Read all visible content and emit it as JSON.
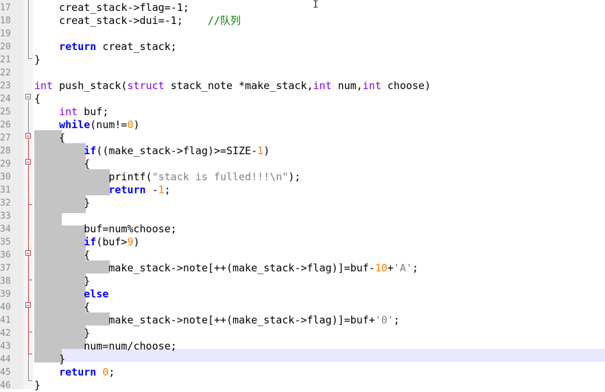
{
  "editor": {
    "lines": [
      {
        "n": "17",
        "parts": [
          {
            "t": "    creat_stack->flag=-1;",
            "c": ""
          }
        ]
      },
      {
        "n": "18",
        "parts": [
          {
            "t": "    creat_stack->dui=-1;    ",
            "c": ""
          },
          {
            "t": "//队列",
            "c": "cm"
          }
        ]
      },
      {
        "n": "19",
        "parts": [
          {
            "t": "",
            "c": ""
          }
        ]
      },
      {
        "n": "20",
        "parts": [
          {
            "t": "    ",
            "c": ""
          },
          {
            "t": "return",
            "c": "kw bold"
          },
          {
            "t": " creat_stack;",
            "c": ""
          }
        ]
      },
      {
        "n": "21",
        "parts": [
          {
            "t": "}",
            "c": ""
          }
        ]
      },
      {
        "n": "22",
        "parts": [
          {
            "t": "",
            "c": ""
          }
        ]
      },
      {
        "n": "23",
        "parts": [
          {
            "t": "int",
            "c": "ty"
          },
          {
            "t": " push_stack(",
            "c": ""
          },
          {
            "t": "struct",
            "c": "ty"
          },
          {
            "t": " stack_note *make_stack,",
            "c": ""
          },
          {
            "t": "int",
            "c": "ty"
          },
          {
            "t": " num,",
            "c": ""
          },
          {
            "t": "int",
            "c": "ty"
          },
          {
            "t": " choose)",
            "c": ""
          }
        ]
      },
      {
        "n": "24",
        "parts": [
          {
            "t": "{",
            "c": ""
          }
        ]
      },
      {
        "n": "25",
        "parts": [
          {
            "t": "    ",
            "c": ""
          },
          {
            "t": "int",
            "c": "ty"
          },
          {
            "t": " buf;",
            "c": ""
          }
        ]
      },
      {
        "n": "26",
        "parts": [
          {
            "t": "    ",
            "c": ""
          },
          {
            "t": "while",
            "c": "kw bold"
          },
          {
            "t": "(num!=",
            "c": ""
          },
          {
            "t": "0",
            "c": "num"
          },
          {
            "t": ")",
            "c": ""
          }
        ]
      },
      {
        "n": "27",
        "parts": [
          {
            "t": "    {",
            "c": ""
          }
        ]
      },
      {
        "n": "28",
        "parts": [
          {
            "t": "        ",
            "c": ""
          },
          {
            "t": "if",
            "c": "kw bold"
          },
          {
            "t": "((make_stack->flag)>=SIZE-",
            "c": ""
          },
          {
            "t": "1",
            "c": "num"
          },
          {
            "t": ")",
            "c": ""
          }
        ]
      },
      {
        "n": "29",
        "parts": [
          {
            "t": "        {",
            "c": ""
          }
        ]
      },
      {
        "n": "30",
        "parts": [
          {
            "t": "            printf(",
            "c": ""
          },
          {
            "t": "\"stack is fulled!!!\\n\"",
            "c": "str"
          },
          {
            "t": ");",
            "c": ""
          }
        ]
      },
      {
        "n": "31",
        "parts": [
          {
            "t": "            ",
            "c": ""
          },
          {
            "t": "return",
            "c": "kw bold"
          },
          {
            "t": " -",
            "c": ""
          },
          {
            "t": "1",
            "c": "num"
          },
          {
            "t": ";",
            "c": ""
          }
        ]
      },
      {
        "n": "32",
        "parts": [
          {
            "t": "        }",
            "c": ""
          }
        ]
      },
      {
        "n": "33",
        "parts": [
          {
            "t": "",
            "c": ""
          }
        ]
      },
      {
        "n": "34",
        "parts": [
          {
            "t": "        buf=num%choose;",
            "c": ""
          }
        ]
      },
      {
        "n": "35",
        "parts": [
          {
            "t": "        ",
            "c": ""
          },
          {
            "t": "if",
            "c": "kw bold"
          },
          {
            "t": "(buf>",
            "c": ""
          },
          {
            "t": "9",
            "c": "num"
          },
          {
            "t": ")",
            "c": ""
          }
        ]
      },
      {
        "n": "36",
        "parts": [
          {
            "t": "        {",
            "c": ""
          }
        ]
      },
      {
        "n": "37",
        "parts": [
          {
            "t": "            make_stack->note[++(make_stack->flag)]=buf-",
            "c": ""
          },
          {
            "t": "10",
            "c": "num"
          },
          {
            "t": "+",
            "c": ""
          },
          {
            "t": "'A'",
            "c": "str"
          },
          {
            "t": ";",
            "c": ""
          }
        ]
      },
      {
        "n": "38",
        "parts": [
          {
            "t": "        }",
            "c": ""
          }
        ]
      },
      {
        "n": "39",
        "parts": [
          {
            "t": "        ",
            "c": ""
          },
          {
            "t": "else",
            "c": "kw bold"
          }
        ]
      },
      {
        "n": "40",
        "parts": [
          {
            "t": "        {",
            "c": ""
          }
        ]
      },
      {
        "n": "41",
        "parts": [
          {
            "t": "            make_stack->note[++(make_stack->flag)]=buf+",
            "c": ""
          },
          {
            "t": "'0'",
            "c": "str"
          },
          {
            "t": ";",
            "c": ""
          }
        ]
      },
      {
        "n": "42",
        "parts": [
          {
            "t": "        }",
            "c": ""
          }
        ]
      },
      {
        "n": "43",
        "parts": [
          {
            "t": "        num=num/choose;",
            "c": ""
          }
        ]
      },
      {
        "n": "44",
        "parts": [
          {
            "t": "    }",
            "c": ""
          }
        ]
      },
      {
        "n": "45",
        "parts": [
          {
            "t": "    ",
            "c": ""
          },
          {
            "t": "return",
            "c": "kw bold"
          },
          {
            "t": " ",
            "c": ""
          },
          {
            "t": "0",
            "c": "num"
          },
          {
            "t": ";",
            "c": ""
          }
        ]
      },
      {
        "n": "46",
        "parts": [
          {
            "t": "}",
            "c": ""
          }
        ]
      }
    ]
  },
  "colors": {
    "keyword": "#0000ff",
    "type": "#8000ff",
    "number": "#ff8000",
    "string": "#808080",
    "comment": "#008000",
    "selection": "#c4c4c4",
    "current_line": "#e8e8ff",
    "fold_marker_active": "#d04040"
  },
  "icons": [
    "fold-collapse-icon",
    "text-cursor-icon"
  ]
}
